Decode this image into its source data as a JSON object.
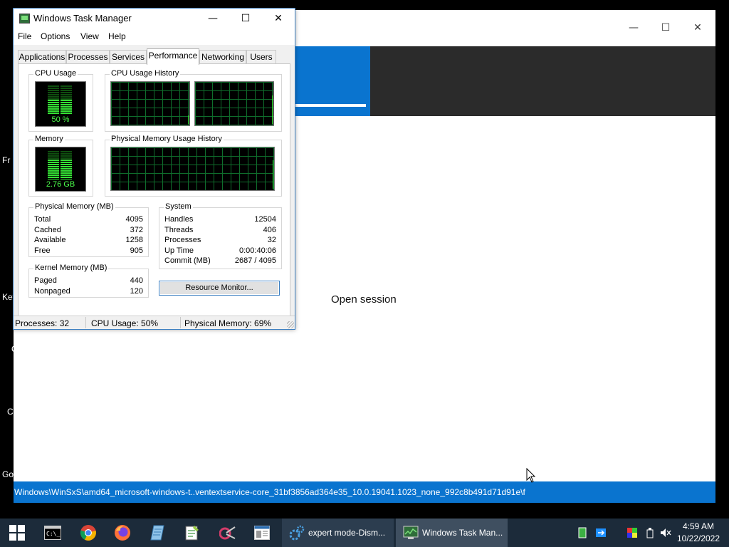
{
  "desktop": {
    "left_labels": [
      "Fr",
      "Key",
      "C",
      "Co",
      "Go"
    ]
  },
  "background_window": {
    "controls": {
      "minimize": "—",
      "maximize": "☐",
      "close": "✕"
    },
    "center_text": "Open session",
    "status_path": "Windows\\WinSxS\\amd64_microsoft-windows-t..ventextservice-core_31bf3856ad364e35_10.0.19041.1023_none_992c8b491d71d91e\\f",
    "progress_fraction": 0.2,
    "colors": {
      "accent": "#0a74cf",
      "banner": "#2b2b2b"
    }
  },
  "task_manager": {
    "title": "Windows Task Manager",
    "controls": {
      "minimize": "—",
      "maximize": "☐",
      "close": "✕"
    },
    "menu": [
      "File",
      "Options",
      "View",
      "Help"
    ],
    "tabs": [
      "Applications",
      "Processes",
      "Services",
      "Performance",
      "Networking",
      "Users"
    ],
    "active_tab": "Performance",
    "cpu_usage": {
      "title": "CPU Usage",
      "label": "50 %",
      "value_percent": 50
    },
    "cpu_history": {
      "title": "CPU Usage History"
    },
    "memory": {
      "title": "Memory",
      "label": "2.76 GB",
      "value_percent": 69
    },
    "memory_history": {
      "title": "Physical Memory Usage History"
    },
    "physical_memory": {
      "title": "Physical Memory (MB)",
      "rows": [
        {
          "label": "Total",
          "value": "4095"
        },
        {
          "label": "Cached",
          "value": "372"
        },
        {
          "label": "Available",
          "value": "1258"
        },
        {
          "label": "Free",
          "value": "905"
        }
      ]
    },
    "kernel_memory": {
      "title": "Kernel Memory (MB)",
      "rows": [
        {
          "label": "Paged",
          "value": "440"
        },
        {
          "label": "Nonpaged",
          "value": "120"
        }
      ]
    },
    "system": {
      "title": "System",
      "rows": [
        {
          "label": "Handles",
          "value": "12504"
        },
        {
          "label": "Threads",
          "value": "406"
        },
        {
          "label": "Processes",
          "value": "32"
        },
        {
          "label": "Up Time",
          "value": "0:00:40:06"
        },
        {
          "label": "Commit (MB)",
          "value": "2687 / 4095"
        }
      ]
    },
    "resource_monitor_button": "Resource Monitor...",
    "status_bar": {
      "processes": "Processes: 32",
      "cpu": "CPU Usage: 50%",
      "memory": "Physical Memory: 69%"
    }
  },
  "taskbar": {
    "apps": [
      {
        "label": "expert mode-Dism...",
        "icon": "gear-icon"
      },
      {
        "label": "Windows Task Man...",
        "icon": "task-manager-icon"
      }
    ],
    "clock": {
      "time": "4:59 AM",
      "date": "10/22/2022"
    },
    "colors": {
      "background": "#1c2b3a",
      "active_app": "#3f4f60"
    }
  }
}
